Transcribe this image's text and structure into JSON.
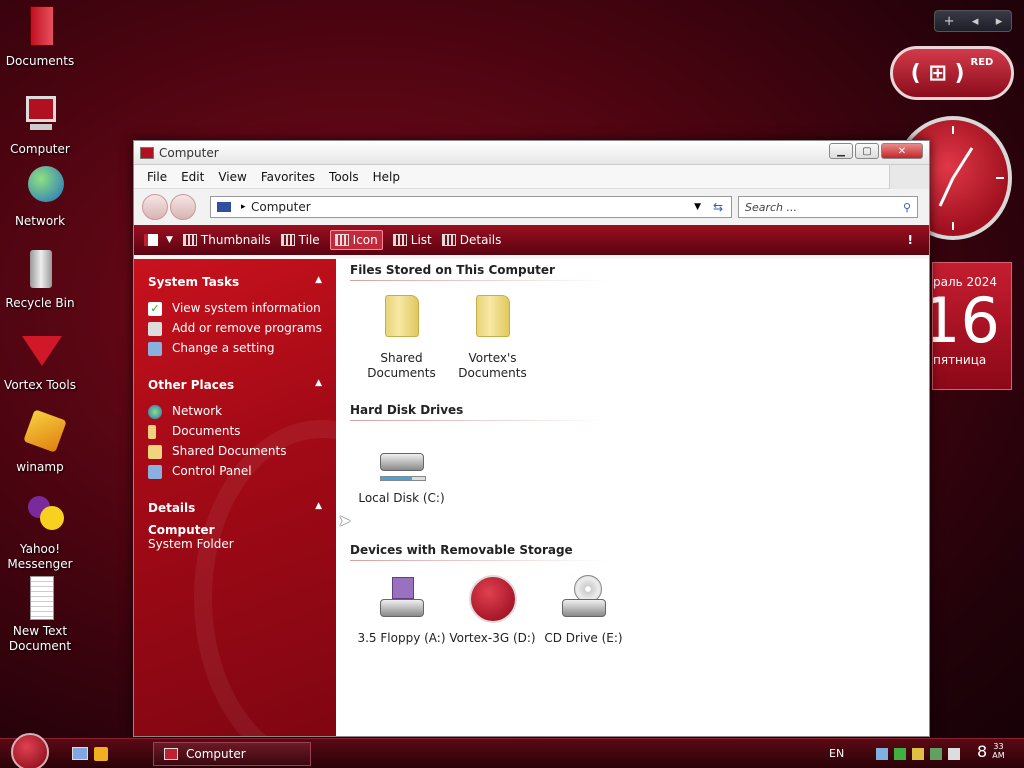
{
  "desktop": {
    "icons": [
      {
        "label": "Documents"
      },
      {
        "label": "Computer"
      },
      {
        "label": "Network"
      },
      {
        "label": "Recycle Bin"
      },
      {
        "label": "Vortex Tools"
      },
      {
        "label": "winamp"
      },
      {
        "label": "Yahoo! Messenger"
      },
      {
        "label": "New Text Document"
      }
    ]
  },
  "gadgets": {
    "sidebar_controls": [
      "+",
      "◂",
      "▸"
    ],
    "badge_text": "RED",
    "calendar": {
      "month_year": "раль 2024",
      "day": "16",
      "weekday": "пятница"
    }
  },
  "window": {
    "title": "Computer",
    "menu": [
      "File",
      "Edit",
      "View",
      "Favorites",
      "Tools",
      "Help"
    ],
    "address": "Computer",
    "search_placeholder": "Search ...",
    "toolbar": {
      "thumbnails": "Thumbnails",
      "tile": "Tile",
      "icon": "Icon",
      "list": "List",
      "details": "Details"
    },
    "sidepanel": {
      "system_tasks": {
        "title": "System Tasks",
        "items": [
          "View system information",
          "Add or remove programs",
          "Change a setting"
        ]
      },
      "other_places": {
        "title": "Other Places",
        "items": [
          "Network",
          "Documents",
          "Shared Documents",
          "Control Panel"
        ]
      },
      "details": {
        "title": "Details",
        "name": "Computer",
        "type": "System Folder"
      }
    },
    "sections": {
      "files_stored": {
        "title": "Files Stored on This Computer",
        "items": [
          "Shared Documents",
          "Vortex's Documents"
        ]
      },
      "hard_disks": {
        "title": "Hard Disk Drives",
        "items": [
          "Local Disk (C:)"
        ]
      },
      "removable": {
        "title": "Devices with Removable Storage",
        "items": [
          "3.5 Floppy (A:)",
          "Vortex-3G (D:)",
          "CD Drive (E:)"
        ]
      }
    }
  },
  "taskbar": {
    "task_label": "Computer",
    "language": "EN",
    "time": "8",
    "time_min": "33",
    "ampm": "AM"
  },
  "colors": {
    "accent": "#c8121e",
    "toolbar_dark": "#5a0210"
  }
}
